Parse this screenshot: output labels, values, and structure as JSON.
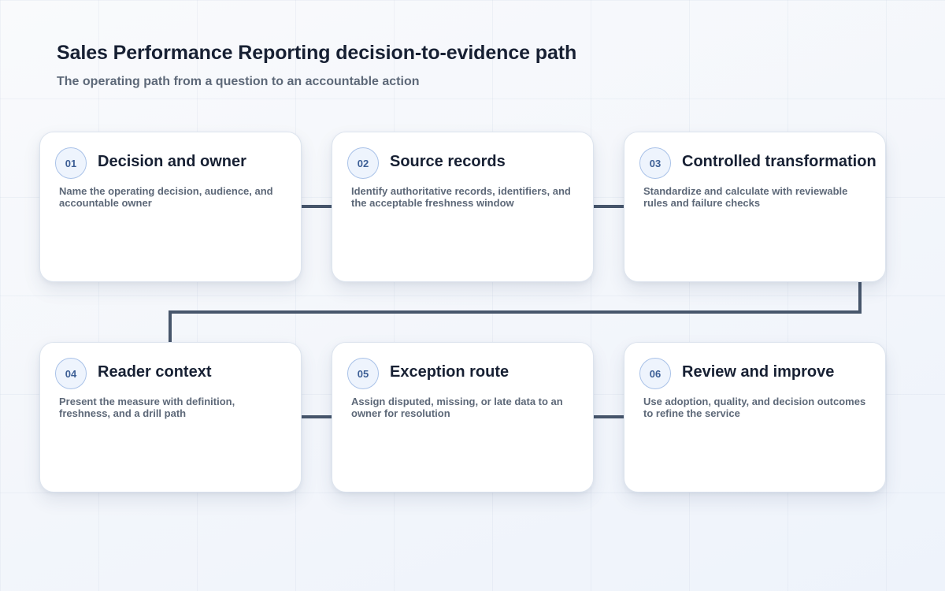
{
  "header": {
    "title": "Sales Performance Reporting decision-to-evidence path",
    "subtitle": "The operating path from a question to an accountable action"
  },
  "colors": {
    "connector": "#47566b",
    "badge_fill": "#eef4fd",
    "badge_border": "#a9c2e8",
    "badge_text": "#3d5f96",
    "title_text": "#172033",
    "body_text": "#5d6878"
  },
  "steps": [
    {
      "number": "01",
      "title": "Decision and owner",
      "description": "Name the operating decision, audience, and accountable owner"
    },
    {
      "number": "02",
      "title": "Source records",
      "description": "Identify authoritative records, identifiers, and the acceptable freshness window"
    },
    {
      "number": "03",
      "title": "Controlled transformation",
      "description": "Standardize and calculate with reviewable rules and failure checks"
    },
    {
      "number": "04",
      "title": "Reader context",
      "description": "Present the measure with definition, freshness, and a drill path"
    },
    {
      "number": "05",
      "title": "Exception route",
      "description": "Assign disputed, missing, or late data to an owner for resolution"
    },
    {
      "number": "06",
      "title": "Review and improve",
      "description": "Use adoption, quality, and decision outcomes to refine the service"
    }
  ]
}
